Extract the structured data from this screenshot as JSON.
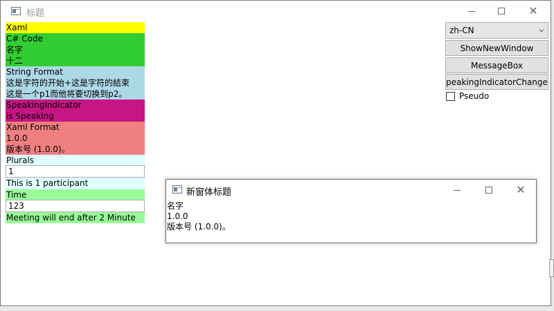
{
  "main_window": {
    "title": "标题",
    "colors": {
      "xaml": "#ffff00",
      "csharp": "#32cd32",
      "string_format": "#add8e6",
      "speaking": "#c71585",
      "xaml_format": "#f08080",
      "plurals": "#e0ffff",
      "time": "#98fb98"
    }
  },
  "blocks": {
    "xaml": {
      "label": "Xaml"
    },
    "csharp": {
      "label": "C# Code",
      "line1": "名字",
      "line2": "十二"
    },
    "string_format": {
      "label": "String Format",
      "line1": "这是字符的开始+这是字符的結束",
      "line2": "这是一个p1而他将要切换到p2。"
    },
    "speaking": {
      "label": "SpeakingIndicator",
      "line1": "is Speaking"
    },
    "xaml_format": {
      "label": "Xaml Format",
      "line1": "1.0.0",
      "line2": "版本号 (1.0.0)。"
    },
    "plurals": {
      "label": "Plurals",
      "input_value": "1",
      "result": "This is 1 participant"
    },
    "time": {
      "label": "Time",
      "input_value": "123",
      "result": "Meeting will end after 2 Minute"
    }
  },
  "controls": {
    "language_select": "zh-CN",
    "show_new_window": "ShowNewWindow",
    "message_box": "MessageBox",
    "speaking_changed": "SpeakingIndicatorChanged",
    "pseudo_label": "Pseudo"
  },
  "sub_window": {
    "title": "新窗体标题",
    "line1": "名字",
    "line2": "1.0.0",
    "line3": "版本号 (1.0.0)。"
  }
}
